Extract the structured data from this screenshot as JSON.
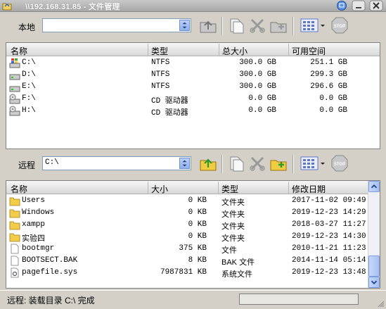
{
  "window": {
    "title": "\\\\192.168.31.85 - 文件管理"
  },
  "local": {
    "label": "本地",
    "path": "",
    "columns": [
      "名称",
      "类型",
      "总大小",
      "可用空间"
    ],
    "rows": [
      {
        "icon": "windows-drive-icon",
        "name": "C:\\",
        "type": "NTFS",
        "total": "300.0 GB",
        "free": "251.1 GB"
      },
      {
        "icon": "hard-drive-icon",
        "name": "D:\\",
        "type": "NTFS",
        "total": "300.0 GB",
        "free": "299.3 GB"
      },
      {
        "icon": "hard-drive-icon",
        "name": "E:\\",
        "type": "NTFS",
        "total": "300.0 GB",
        "free": "296.6 GB"
      },
      {
        "icon": "cd-drive-icon",
        "name": "F:\\",
        "type": "CD 驱动器",
        "total": "0.0 GB",
        "free": "0.0 GB"
      },
      {
        "icon": "cd-drive-icon",
        "name": "H:\\",
        "type": "CD 驱动器",
        "total": "0.0 GB",
        "free": "0.0 GB"
      }
    ]
  },
  "remote": {
    "label": "远程",
    "path": "C:\\",
    "columns": [
      "名称",
      "大小",
      "类型",
      "修改日期"
    ],
    "rows": [
      {
        "icon": "folder-icon",
        "name": "Users",
        "size": "0 KB",
        "type": "文件夹",
        "date": "2017-11-02 09:49"
      },
      {
        "icon": "folder-icon",
        "name": "Windows",
        "size": "0 KB",
        "type": "文件夹",
        "date": "2019-12-23 14:29"
      },
      {
        "icon": "folder-icon",
        "name": "xampp",
        "size": "0 KB",
        "type": "文件夹",
        "date": "2018-03-27 11:27"
      },
      {
        "icon": "folder-icon",
        "name": "实验四",
        "size": "0 KB",
        "type": "文件夹",
        "date": "2019-12-23 14:30"
      },
      {
        "icon": "file-icon",
        "name": "bootmgr",
        "size": "375 KB",
        "type": "文件",
        "date": "2010-11-21 11:23"
      },
      {
        "icon": "file-icon",
        "name": "BOOTSECT.BAK",
        "size": "8 KB",
        "type": "BAK 文件",
        "date": "2014-11-14 05:14"
      },
      {
        "icon": "system-file-icon",
        "name": "pagefile.sys",
        "size": "7987831 KB",
        "type": "系统文件",
        "date": "2019-12-23 13:48"
      }
    ]
  },
  "status": {
    "text": "远程: 装载目录 C:\\ 完成"
  },
  "colors": {
    "chrome": "#d4d0c8",
    "accent": "#7f9db9"
  }
}
